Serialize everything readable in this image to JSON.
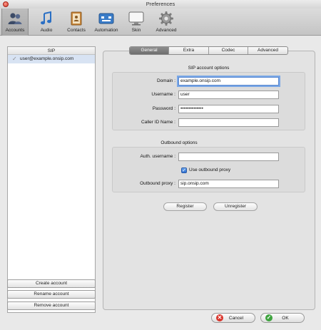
{
  "window": {
    "title": "Preferences"
  },
  "toolbar": {
    "items": [
      {
        "label": "Accounts",
        "icon": "accounts-icon"
      },
      {
        "label": "Audio",
        "icon": "music-note-icon"
      },
      {
        "label": "Contacts",
        "icon": "address-book-icon"
      },
      {
        "label": "Automation",
        "icon": "automation-icon"
      },
      {
        "label": "Skin",
        "icon": "display-icon"
      },
      {
        "label": "Advanced",
        "icon": "gear-icon"
      }
    ],
    "selected": "Accounts"
  },
  "accounts": {
    "header": "SIP",
    "rows": [
      {
        "name": "user@example.onsip.com",
        "enabled": true
      }
    ]
  },
  "account_buttons": {
    "create": "Create account",
    "rename": "Rename account",
    "remove": "Remove account"
  },
  "tabs": {
    "items": [
      "General",
      "Extra",
      "Codec",
      "Advanced"
    ],
    "selected": "General"
  },
  "sip_options": {
    "title": "SIP account options",
    "domain_label": "Domain :",
    "domain_value": "example.onsip.com",
    "username_label": "Username :",
    "username_value": "user",
    "password_label": "Password :",
    "password_value": "••••••••••••••",
    "callerid_label": "Caller ID Name :",
    "callerid_value": ""
  },
  "outbound_options": {
    "title": "Outbound options",
    "auth_label": "Auth. username :",
    "auth_value": "",
    "use_proxy_label": "Use outbound proxy",
    "use_proxy_checked": true,
    "proxy_label": "Outbound proxy :",
    "proxy_value": "sip.onsip.com"
  },
  "actions": {
    "register": "Register",
    "unregister": "Unregister"
  },
  "footer": {
    "cancel": "Cancel",
    "ok": "OK"
  },
  "colors": {
    "selection": "#d8e3f3",
    "tab_selected": "#7b7b7b",
    "focus_ring": "#7aa7e6",
    "checkbox": "#3b7ddb",
    "cancel_icon": "#d9342b",
    "ok_icon": "#3ea33e"
  }
}
